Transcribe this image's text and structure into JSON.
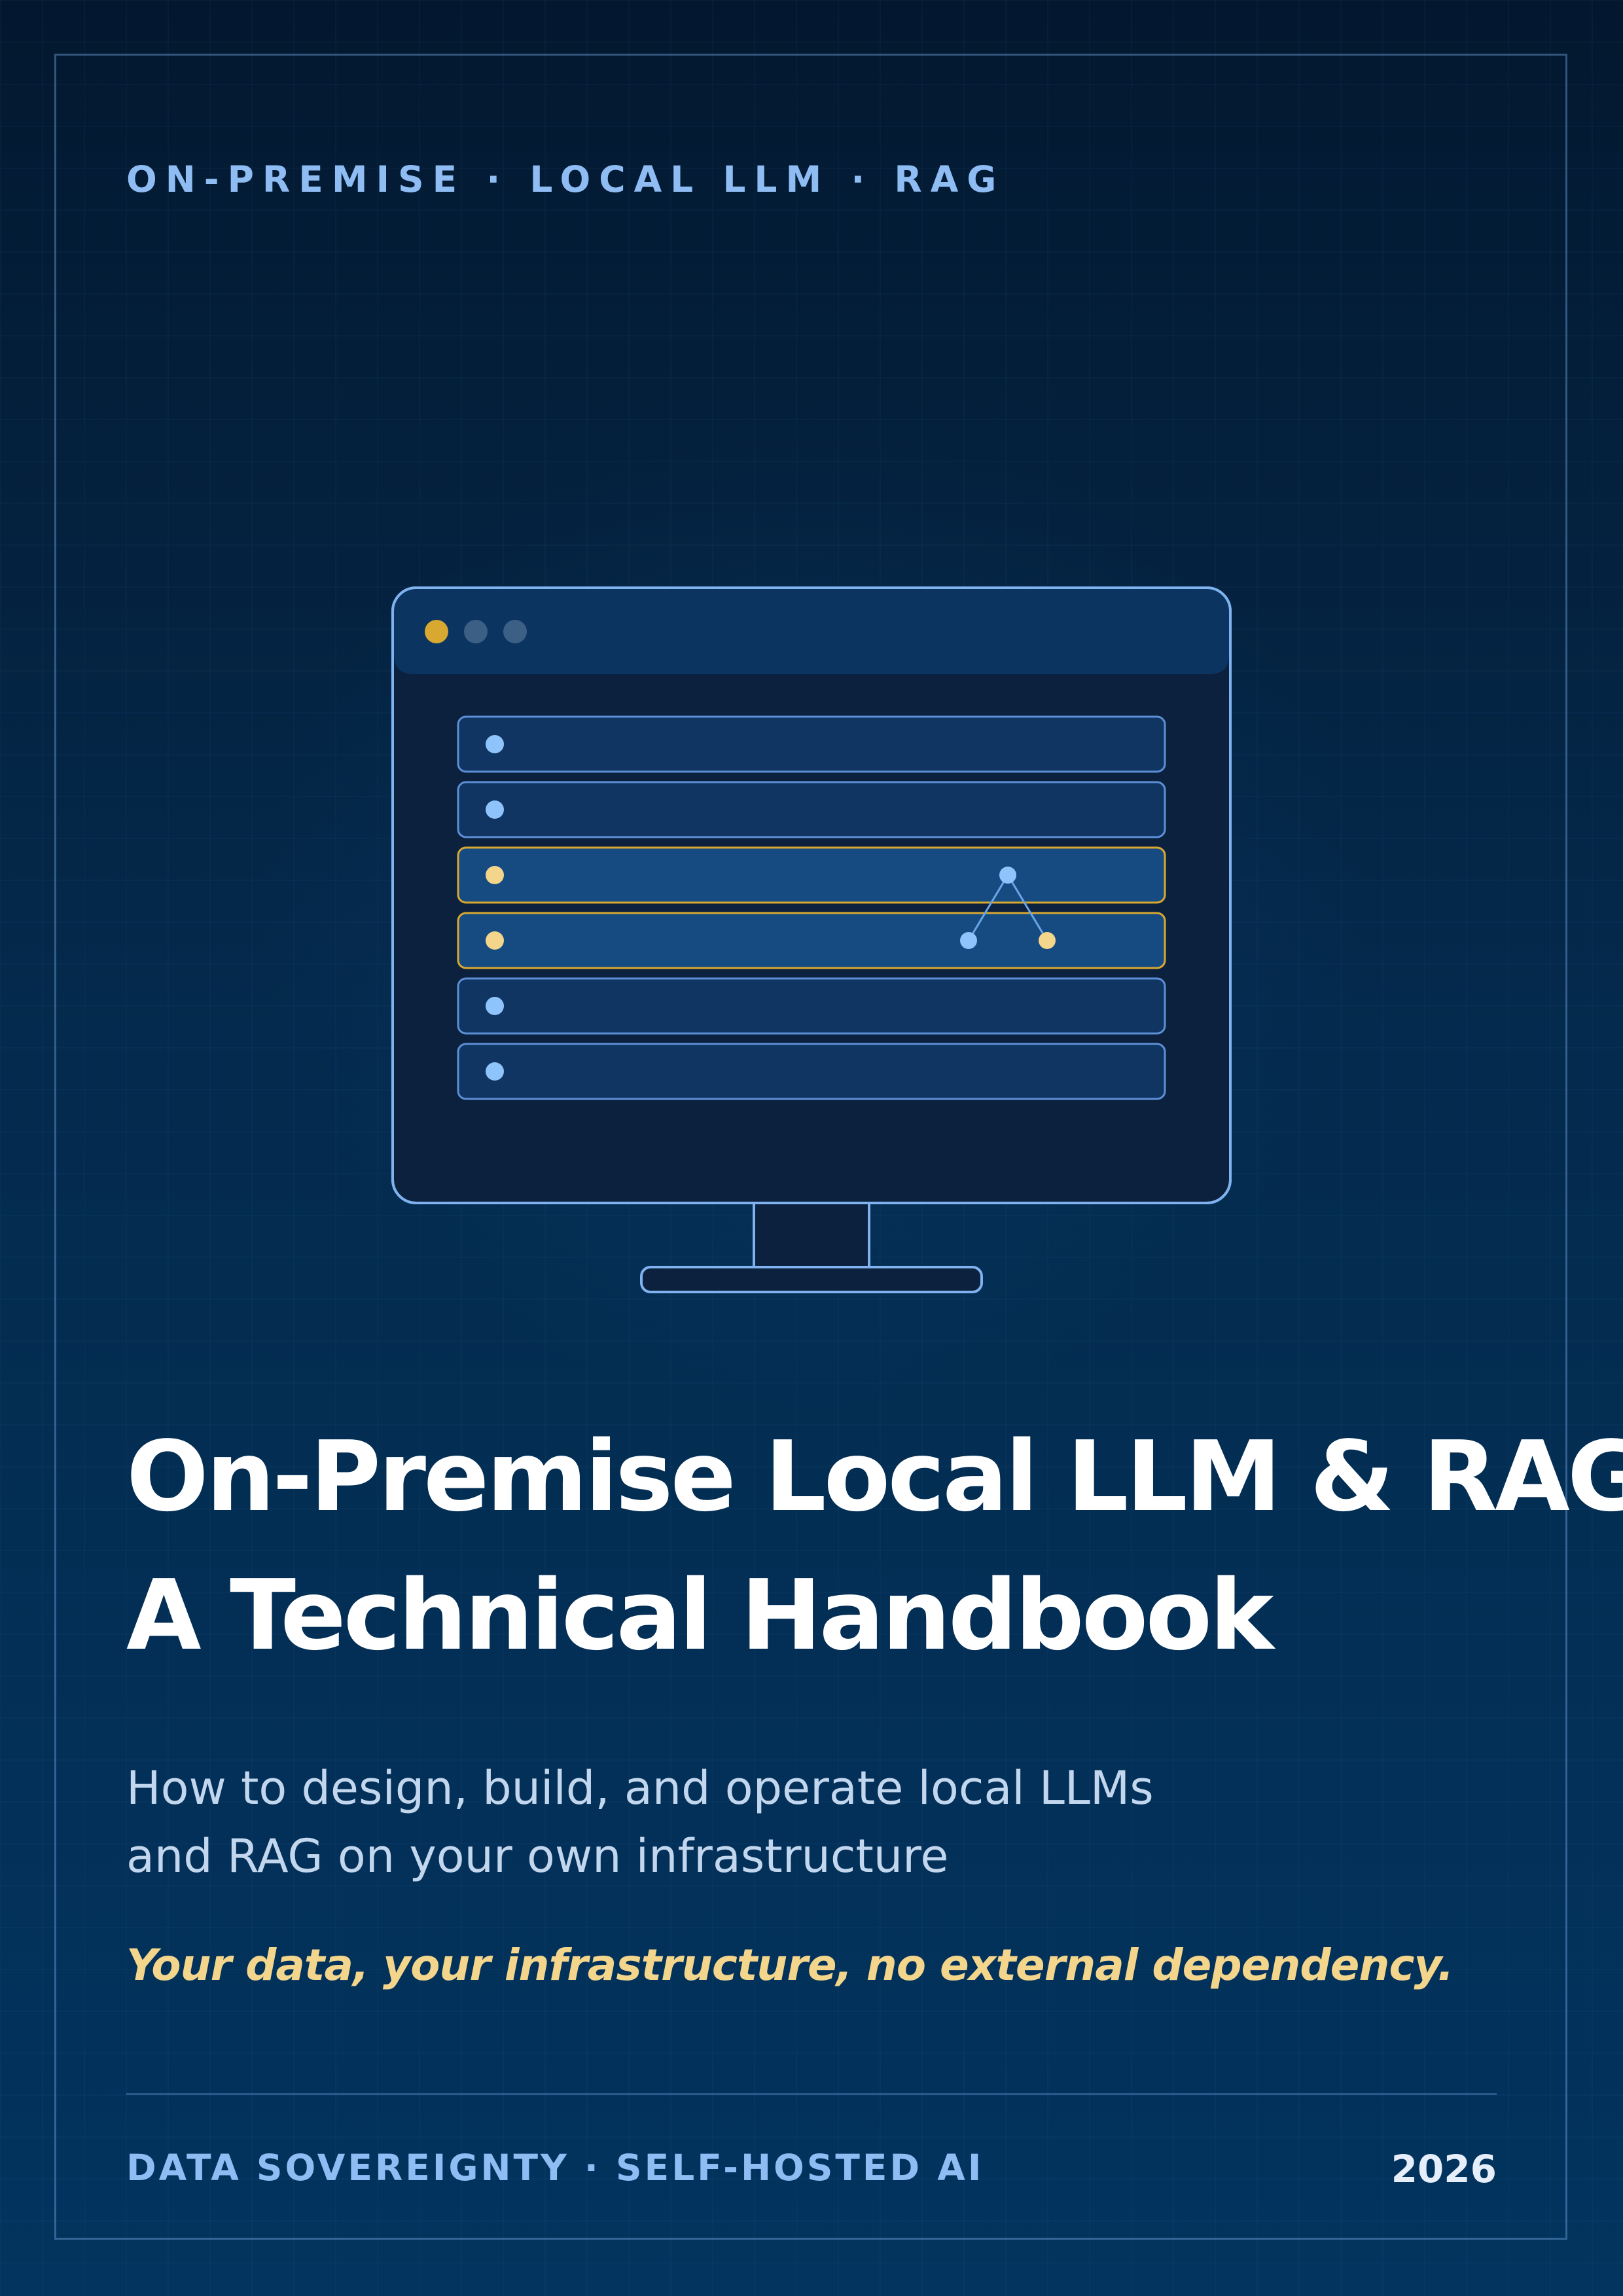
{
  "header": {
    "tagline": "ON-PREMISE · LOCAL LLM · RAG"
  },
  "illustration": {
    "icon": "computer-monitor-icon",
    "window_dots": [
      "dot-accent",
      "dot-muted",
      "dot-muted"
    ],
    "highlighted_rows": [
      3,
      4
    ]
  },
  "title": {
    "line1": "On-Premise Local LLM & RAG",
    "line2": "A Technical Handbook"
  },
  "subtitle": {
    "line1": "How to design, build, and operate local LLMs",
    "line2": "and RAG on your own infrastructure"
  },
  "tagline": "Your data, your infrastructure, no external dependency.",
  "footer": {
    "left": "DATA SOVEREIGNTY · SELF-HOSTED AI",
    "year": "2026"
  },
  "colors": {
    "background_top": "#03182f",
    "background_bottom": "#02345f",
    "accent_blue": "#8ebcf3",
    "accent_gold": "#d9a830",
    "tagline_gold": "#f3d58c",
    "title": "#ffffff"
  }
}
